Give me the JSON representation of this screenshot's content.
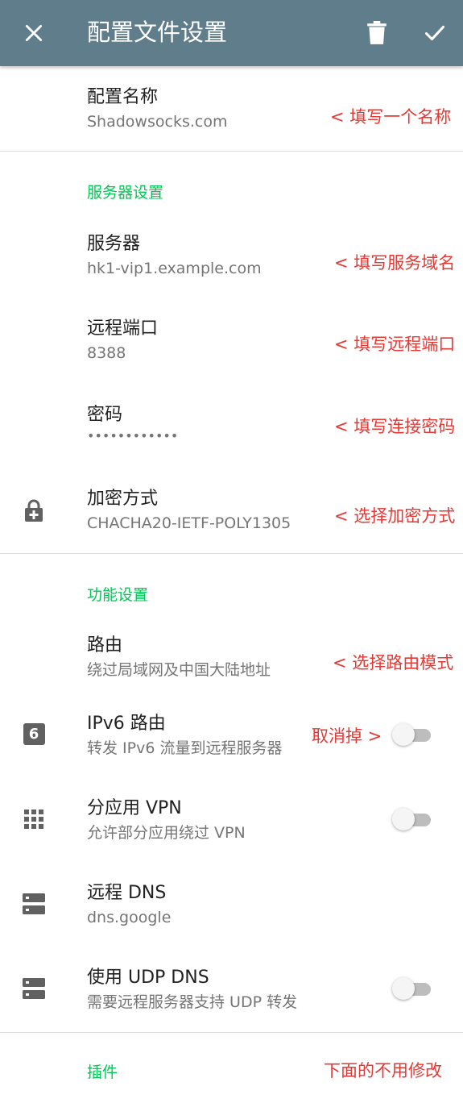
{
  "appbar": {
    "title": "配置文件设置",
    "close_icon": "close-icon",
    "delete_icon": "trash-icon",
    "apply_icon": "check-icon"
  },
  "profile": {
    "name_title": "配置名称",
    "name_value": "Shadowsocks.com",
    "name_note": "< 填写一个名称"
  },
  "server_section": {
    "header": "服务器设置",
    "server_title": "服务器",
    "server_value": "hk1-vip1.example.com",
    "server_note": "< 填写服务域名",
    "port_title": "远程端口",
    "port_value": "8388",
    "port_note": "< 填写远程端口",
    "password_title": "密码",
    "password_value": "••••••••••••",
    "password_note": "< 填写连接密码",
    "method_title": "加密方式",
    "method_value": "CHACHA20-IETF-POLY1305",
    "method_note": "< 选择加密方式"
  },
  "feature_section": {
    "header": "功能设置",
    "route_title": "路由",
    "route_value": "绕过局域网及中国大陆地址",
    "route_note": "< 选择路由模式",
    "ipv6_title": "IPv6 路由",
    "ipv6_value": "转发 IPv6 流量到远程服务器",
    "ipv6_icon_text": "6",
    "ipv6_note": "取消掉 >",
    "ipv6_enabled": false,
    "perapp_title": "分应用 VPN",
    "perapp_value": "允许部分应用绕过 VPN",
    "perapp_enabled": false,
    "dns_title": "远程 DNS",
    "dns_value": "dns.google",
    "udpdns_title": "使用 UDP DNS",
    "udpdns_value": "需要远程服务器支持 UDP 转发",
    "udpdns_enabled": false
  },
  "plugin_section": {
    "header": "插件",
    "note": "下面的不用修改"
  },
  "colors": {
    "appbar": "#607d8b",
    "accent": "#00c853",
    "annotation": "#e53935"
  }
}
